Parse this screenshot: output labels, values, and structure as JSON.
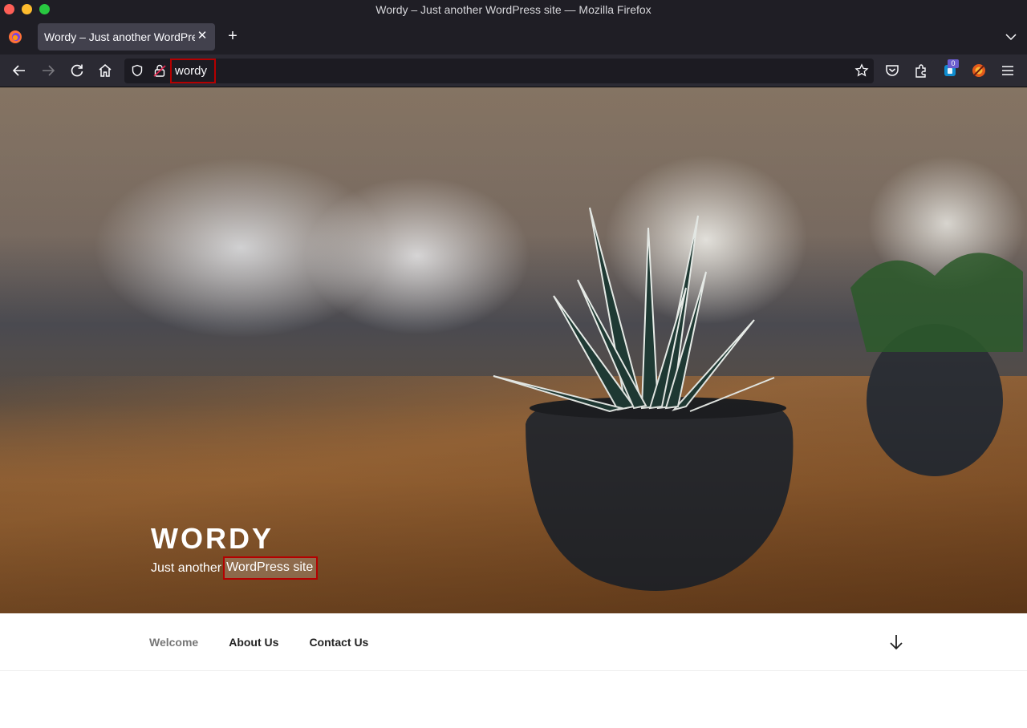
{
  "window": {
    "title": "Wordy – Just another WordPress site — Mozilla Firefox"
  },
  "tabs": [
    {
      "label": "Wordy – Just another WordPress site"
    }
  ],
  "urlbar": {
    "value": "wordy"
  },
  "toolbar": {
    "extension_badge": "0"
  },
  "site": {
    "title": "Wordy",
    "description_prefix": "Just another",
    "description_highlight": "WordPress site"
  },
  "menu": {
    "items": [
      {
        "label": "Welcome"
      },
      {
        "label": "About Us"
      },
      {
        "label": "Contact Us"
      }
    ]
  },
  "colors": {
    "highlight_border": "#b40000",
    "menu_current": "#767676",
    "menu_text": "#222222"
  }
}
